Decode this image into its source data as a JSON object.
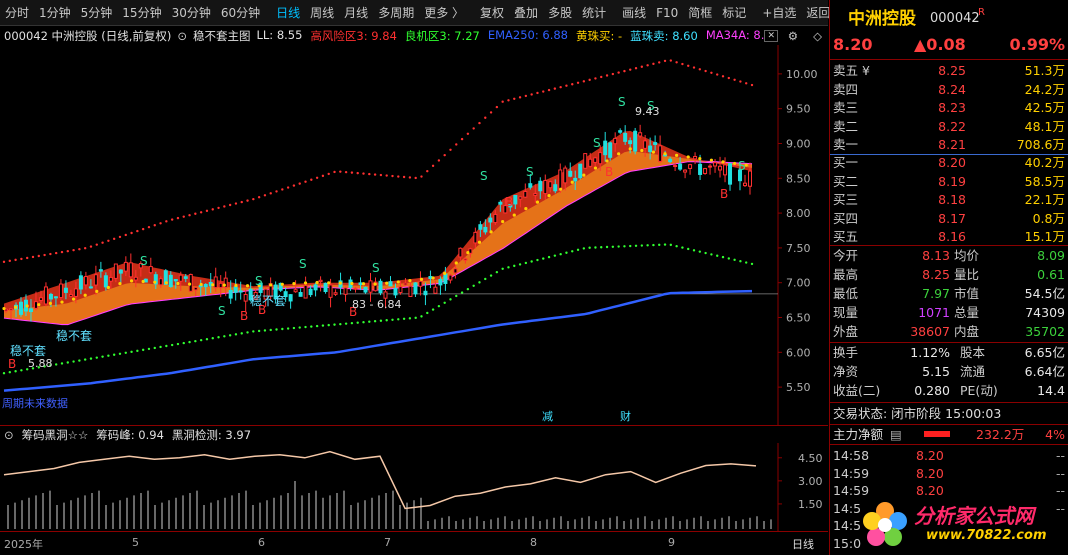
{
  "toolbar": {
    "items": [
      "分时",
      "1分钟",
      "5分钟",
      "15分钟",
      "30分钟",
      "60分钟",
      "日线",
      "周线",
      "月线",
      "多周期",
      "更多 〉",
      "复权",
      "叠加",
      "多股",
      "统计",
      "画线",
      "F10",
      "简框",
      "标记",
      "+自选",
      "返回"
    ]
  },
  "legend": {
    "code_name": "000042 中洲控股 (日线,前复权)",
    "indicator": "稳不套主图",
    "items": [
      {
        "text": "LL: 8.55",
        "color": "#e0e0e0"
      },
      {
        "text": "高风险区3: 9.84",
        "color": "#ff3030"
      },
      {
        "text": "良机区3: 7.27",
        "color": "#30ff30"
      },
      {
        "text": "EMA250: 6.88",
        "color": "#3060ff"
      },
      {
        "text": "黄珠买: -",
        "color": "#ffd000"
      },
      {
        "text": "蓝珠卖: 8.60",
        "color": "#40e0ff"
      },
      {
        "text": "MA34A: 8.",
        "color": "#ff40ff"
      }
    ]
  },
  "main_labels": {
    "annotations": [
      "S",
      "S",
      "S",
      "S",
      "S",
      "S",
      "S",
      "S",
      "S",
      "S",
      "S",
      "B",
      "B",
      "B",
      "B",
      "B",
      "B",
      "B"
    ],
    "wubutao1": "稳不套",
    "wubutao2": "稳不套",
    "wubutao3": "稳不套",
    "low_val1": "5.88",
    "low_val2": "83 - 6.84",
    "hi_val": "9.43",
    "nodata": "周期未来数据",
    "mark1": "减",
    "mark2": "财"
  },
  "y_axis": [
    "10.00",
    "9.50",
    "9.00",
    "8.50",
    "8.00",
    "7.50",
    "7.00",
    "6.50",
    "6.00",
    "5.50"
  ],
  "sub_legend": {
    "title": "筹码黑洞☆☆",
    "peak": "筹码峰: 0.94",
    "detect": "黑洞检测: 3.97"
  },
  "sub_y_axis": [
    "4.50",
    "3.00",
    "1.50"
  ],
  "x_axis": {
    "labels": [
      "2025年",
      "5",
      "6",
      "7",
      "8",
      "9"
    ],
    "period": "日线"
  },
  "quote": {
    "name": "中洲控股",
    "code": "000042",
    "flag": "R",
    "price": "8.20",
    "change": "▲0.08",
    "pct": "0.99%",
    "asks": [
      {
        "label": "卖五 ¥",
        "price": "8.25",
        "vol": "51.3万"
      },
      {
        "label": "卖四",
        "price": "8.24",
        "vol": "24.2万"
      },
      {
        "label": "卖三",
        "price": "8.23",
        "vol": "42.5万"
      },
      {
        "label": "卖二",
        "price": "8.22",
        "vol": "48.1万"
      },
      {
        "label": "卖一",
        "price": "8.21",
        "vol": "708.6万"
      }
    ],
    "bids": [
      {
        "label": "买一",
        "price": "8.20",
        "vol": "40.2万"
      },
      {
        "label": "买二",
        "price": "8.19",
        "vol": "58.5万"
      },
      {
        "label": "买三",
        "price": "8.18",
        "vol": "22.1万"
      },
      {
        "label": "买四",
        "price": "8.17",
        "vol": "0.8万"
      },
      {
        "label": "买五",
        "price": "8.16",
        "vol": "15.1万"
      }
    ],
    "stats": [
      {
        "l1": "今开",
        "v1": "8.13",
        "c1": "red",
        "l2": "均价",
        "v2": "8.09",
        "c2": "green"
      },
      {
        "l1": "最高",
        "v1": "8.25",
        "c1": "red",
        "l2": "量比",
        "v2": "0.61",
        "c2": "green"
      },
      {
        "l1": "最低",
        "v1": "7.97",
        "c1": "green",
        "l2": "市值",
        "v2": "54.5亿",
        "c2": "white"
      },
      {
        "l1": "现量",
        "v1": "1071",
        "c1": "purple",
        "l2": "总量",
        "v2": "74309",
        "c2": "white"
      },
      {
        "l1": "外盘",
        "v1": "38607",
        "c1": "red",
        "l2": "内盘",
        "v2": "35702",
        "c2": "green"
      }
    ],
    "stats2": [
      {
        "l1": "换手",
        "v1": "1.12%",
        "l2": "股本",
        "v2": "6.65亿"
      },
      {
        "l1": "净资",
        "v1": "5.15",
        "l2": "流通",
        "v2": "6.64亿"
      },
      {
        "l1": "收益(二)",
        "v1": "0.280",
        "l2": "PE(动)",
        "v2": "14.4"
      }
    ],
    "status": "交易状态: 闭市阶段 15:00:03",
    "net_label": "主力净额",
    "net_value": "232.2万",
    "net_pct": "4%",
    "ticks": [
      {
        "time": "14:58",
        "price": "8.20",
        "vol": "--"
      },
      {
        "time": "14:59",
        "price": "8.20",
        "vol": "--"
      },
      {
        "time": "14:59",
        "price": "8.20",
        "vol": "--"
      },
      {
        "time": "14:5",
        "price": "",
        "vol": "--"
      },
      {
        "time": "14:5",
        "price": "",
        "vol": ""
      },
      {
        "time": "15:0",
        "price": "",
        "vol": ""
      }
    ],
    "watermark": "分析家公式网",
    "watermark_url": "www.70822.com"
  },
  "chart_data": {
    "type": "line",
    "title": "",
    "xlabel": "",
    "ylabel": "",
    "ylim": [
      5.2,
      10.3
    ],
    "x": [
      "2025年",
      "5",
      "6",
      "7",
      "8",
      "9"
    ],
    "series": [
      {
        "name": "MA34A",
        "color": "#ff40ff",
        "values": [
          6.5,
          6.4,
          6.7,
          6.8,
          6.9,
          6.95,
          6.9,
          7.0,
          7.5,
          8.1,
          8.6,
          8.75,
          8.7
        ]
      },
      {
        "name": "EMA250",
        "color": "#3060ff",
        "values": [
          5.45,
          5.55,
          5.7,
          5.9,
          6.0,
          6.2,
          6.4,
          6.55,
          6.85,
          6.88
        ]
      },
      {
        "name": "高风险区3",
        "color": "#ff3030",
        "values": [
          7.3,
          7.5,
          7.9,
          8.2,
          8.6,
          8.5,
          9.6,
          9.9,
          10.2,
          9.84
        ]
      },
      {
        "name": "良机区3",
        "color": "#30ff30",
        "values": [
          5.7,
          5.9,
          6.1,
          6.3,
          6.4,
          6.5,
          7.2,
          7.5,
          7.55,
          7.27
        ]
      }
    ]
  },
  "sub_chart_data": {
    "type": "line",
    "values": [
      3.4,
      3.6,
      3.8,
      4.2,
      4.4,
      4.6,
      4.4,
      4.5,
      4.7,
      4.4,
      4.6,
      4.7,
      4.5,
      4.9,
      4.4,
      4.6,
      1.2,
      1.4,
      2.0,
      2.2,
      2.6,
      2.8,
      3.2,
      2.9,
      3.4,
      3.6,
      2.9,
      3.5,
      4.0,
      4.1,
      3.97
    ]
  }
}
